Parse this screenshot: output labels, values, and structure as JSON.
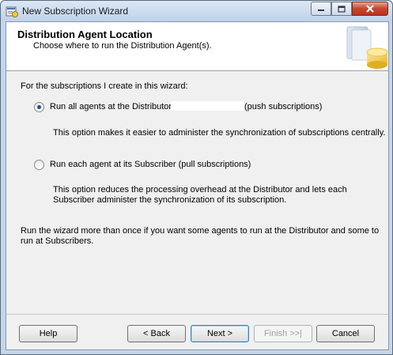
{
  "window": {
    "title": "New Subscription Wizard",
    "icons": {
      "app": "wizard-app-icon",
      "minimize": "minimize-icon",
      "maximize": "maximize-icon",
      "close": "close-icon"
    }
  },
  "header": {
    "title": "Distribution Agent Location",
    "subtitle": "Choose where to run the Distribution Agent(s).",
    "image": "database-wizard-icon"
  },
  "content": {
    "intro": "For the subscriptions I create in this wizard:",
    "options": [
      {
        "label_prefix": "Run all agents at the Distributor,",
        "label_suffix": "(push subscriptions)",
        "description": "This option makes it easier to administer the synchronization of subscriptions centrally.",
        "selected": true
      },
      {
        "label": "Run each agent at its Subscriber (pull subscriptions)",
        "description_line1": "This option reduces the processing overhead at the Distributor and lets each",
        "description_line2": "Subscriber administer the synchronization of its subscription.",
        "selected": false
      }
    ],
    "note_line1": "Run the wizard more than once if you want some agents to run at the Distributor and some to",
    "note_line2": "run at Subscribers."
  },
  "buttons": {
    "help": "Help",
    "back": "< Back",
    "next": "Next >",
    "finish": "Finish >>|",
    "cancel": "Cancel"
  }
}
